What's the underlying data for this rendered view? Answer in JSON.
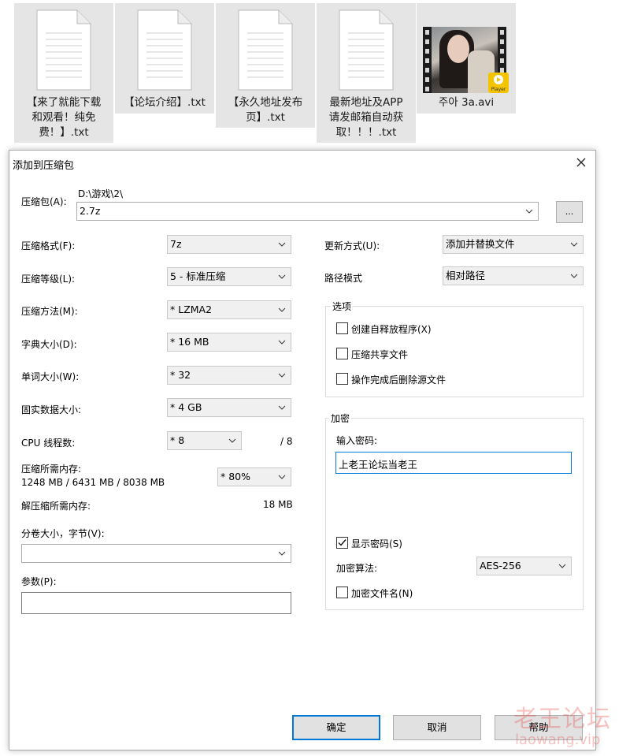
{
  "files": [
    {
      "name_lines": [
        "【来了就能下载",
        "和观看！纯免",
        "费！】.txt"
      ]
    },
    {
      "name_lines": [
        "【论坛介绍】.txt"
      ]
    },
    {
      "name_lines": [
        "【永久地址发布",
        "页】.txt"
      ]
    },
    {
      "name_lines": [
        "最新地址及APP",
        "请发邮箱自动获",
        "取！！！.txt"
      ]
    },
    {
      "name_lines": [
        "주아 3a.avi"
      ],
      "badge_text": "Player"
    }
  ],
  "dialog": {
    "title": "添加到压缩包",
    "archive": {
      "label": "压缩包(A):",
      "path": "D:\\游戏\\2\\",
      "value": "2.7z",
      "browse_label": "..."
    },
    "left": {
      "format": {
        "label": "压缩格式(F):",
        "value": "7z"
      },
      "level": {
        "label": "压缩等级(L):",
        "value": "5 - 标准压缩"
      },
      "method": {
        "label": "压缩方法(M):",
        "value": "* LZMA2"
      },
      "dict": {
        "label": "字典大小(D):",
        "value": "* 16 MB"
      },
      "word": {
        "label": "单词大小(W):",
        "value": "* 32"
      },
      "solid": {
        "label": "固实数据大小:",
        "value": "* 4 GB"
      },
      "threads": {
        "label": "CPU 线程数:",
        "value": "* 8",
        "max": "/ 8"
      },
      "memory": {
        "label": "压缩所需内存:",
        "detail": "1248 MB / 6431 MB / 8038 MB",
        "value": "* 80%"
      },
      "decomp": {
        "label": "解压缩所需内存:",
        "value": "18 MB"
      },
      "volume": {
        "label": "分卷大小，字节(V):",
        "value": ""
      },
      "params": {
        "label": "参数(P):",
        "value": ""
      }
    },
    "right": {
      "update": {
        "label": "更新方式(U):",
        "value": "添加并替换文件"
      },
      "path_mode": {
        "label": "路径模式",
        "value": "相对路径"
      },
      "options": {
        "title": "选项",
        "items": [
          {
            "label": "创建自释放程序(X)",
            "checked": false
          },
          {
            "label": "压缩共享文件",
            "checked": false
          },
          {
            "label": "操作完成后删除源文件",
            "checked": false
          }
        ]
      },
      "encryption": {
        "title": "加密",
        "password_label": "输入密码:",
        "password_value": "上老王论坛当老王",
        "show_password": {
          "label": "显示密码(S)",
          "checked": true
        },
        "method_label": "加密算法:",
        "method_value": "AES-256",
        "encrypt_names": {
          "label": "加密文件名(N)",
          "checked": false
        }
      }
    },
    "buttons": {
      "ok": "确定",
      "cancel": "取消",
      "help": "帮助"
    }
  },
  "watermark": {
    "cn": "老王论坛",
    "url": "laowang.vip"
  }
}
